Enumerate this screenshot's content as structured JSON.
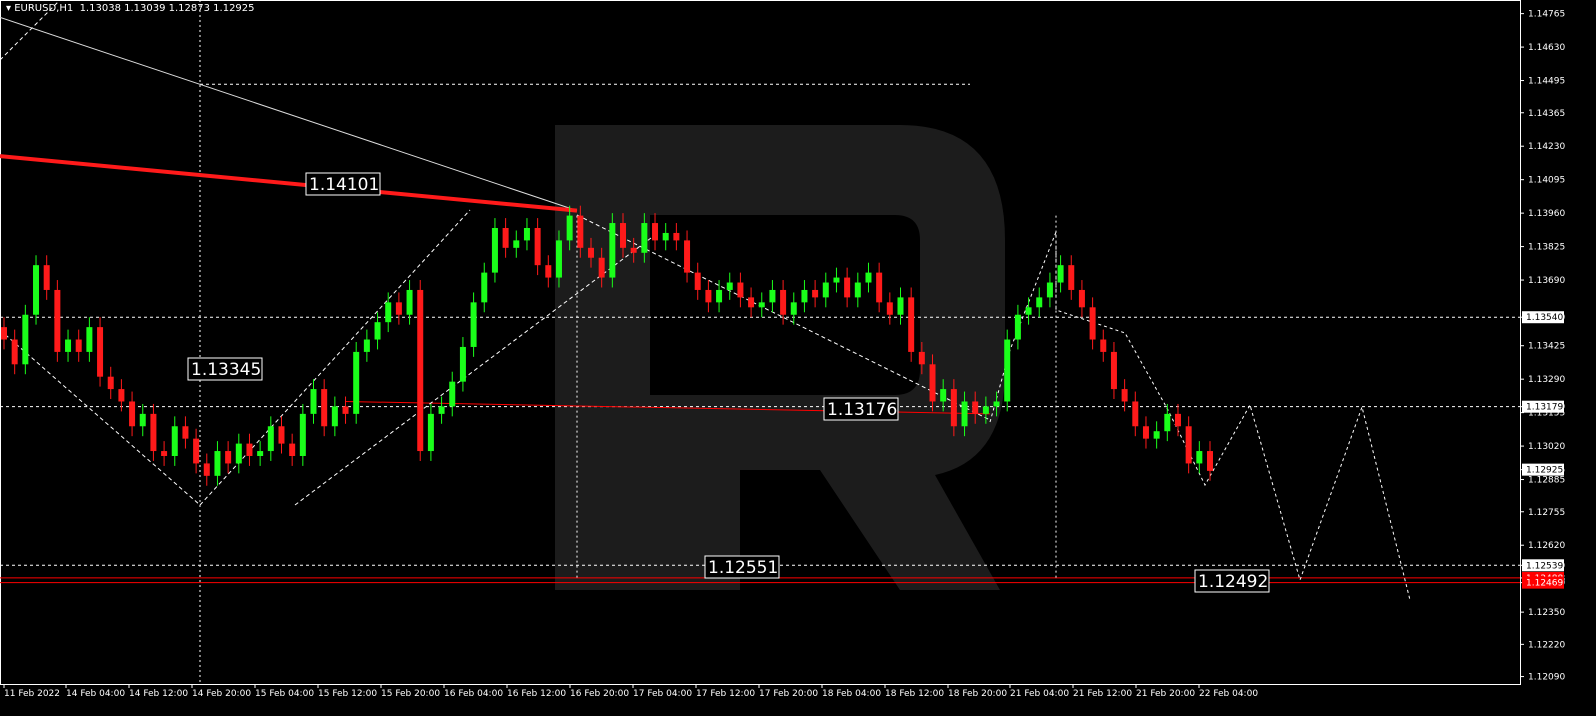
{
  "header": {
    "menu_icon": "triangle-down-icon",
    "text": "EURUSD,H1  1.13038 1.13039 1.12873 1.12925"
  },
  "chart_data": {
    "type": "candlestick",
    "symbol": "EURUSD",
    "timeframe": "H1",
    "ohlc": {
      "open": 1.13038,
      "high": 1.13039,
      "low": 1.12873,
      "close": 1.12925
    },
    "ylim": [
      1.1206,
      1.1482
    ],
    "y_ticks": [
      "1.14765",
      "1.14630",
      "1.14495",
      "1.14365",
      "1.14230",
      "1.14095",
      "1.13960",
      "1.13825",
      "1.13690",
      "1.13540",
      "1.13425",
      "1.13290",
      "1.13179",
      "1.13155",
      "1.13020",
      "1.12925",
      "1.12885",
      "1.12755",
      "1.12620",
      "1.12539",
      "1.12488",
      "1.12469",
      "1.12350",
      "1.12220",
      "1.12090"
    ],
    "x_ticks": [
      "11 Feb 2022",
      "14 Feb 04:00",
      "14 Feb 12:00",
      "14 Feb 20:00",
      "15 Feb 04:00",
      "15 Feb 12:00",
      "15 Feb 20:00",
      "16 Feb 04:00",
      "16 Feb 12:00",
      "16 Feb 20:00",
      "17 Feb 04:00",
      "17 Feb 12:00",
      "17 Feb 20:00",
      "18 Feb 04:00",
      "18 Feb 12:00",
      "18 Feb 20:00",
      "21 Feb 04:00",
      "21 Feb 12:00",
      "21 Feb 20:00",
      "22 Feb 04:00"
    ],
    "price_labels": [
      {
        "value": "1.13540",
        "style": "white"
      },
      {
        "value": "1.13179",
        "style": "white"
      },
      {
        "value": "1.12925",
        "style": "white"
      },
      {
        "value": "1.12539",
        "style": "white"
      },
      {
        "value": "1.12488",
        "style": "red"
      },
      {
        "value": "1.12469",
        "style": "red"
      }
    ],
    "annotations": [
      "1.14101",
      "1.13345",
      "1.13176",
      "1.12551",
      "1.12492"
    ],
    "close_path": [
      1.1345,
      1.1335,
      1.1355,
      1.1375,
      1.1365,
      1.134,
      1.1345,
      1.134,
      1.135,
      1.133,
      1.1325,
      1.132,
      1.131,
      1.1315,
      1.13,
      1.1298,
      1.131,
      1.1305,
      1.1295,
      1.129,
      1.13,
      1.1295,
      1.1303,
      1.1298,
      1.13,
      1.131,
      1.1303,
      1.1298,
      1.1315,
      1.1325,
      1.131,
      1.1318,
      1.1315,
      1.134,
      1.1345,
      1.1352,
      1.136,
      1.1355,
      1.1365,
      1.13,
      1.1315,
      1.1318,
      1.1328,
      1.1342,
      1.136,
      1.1372,
      1.139,
      1.1382,
      1.1385,
      1.139,
      1.1375,
      1.137,
      1.1385,
      1.1395,
      1.1382,
      1.1378,
      1.137,
      1.1392,
      1.1382,
      1.138,
      1.1392,
      1.1385,
      1.1388,
      1.1385,
      1.1372,
      1.1365,
      1.136,
      1.1365,
      1.1368,
      1.1362,
      1.1358,
      1.136,
      1.1365,
      1.1355,
      1.136,
      1.1365,
      1.1362,
      1.1368,
      1.137,
      1.1362,
      1.1368,
      1.1372,
      1.136,
      1.1355,
      1.1362,
      1.134,
      1.1335,
      1.132,
      1.1325,
      1.131,
      1.132,
      1.1315,
      1.1318,
      1.132,
      1.1345,
      1.1355,
      1.1358,
      1.1362,
      1.1368,
      1.1375,
      1.1365,
      1.1358,
      1.1345,
      1.134,
      1.1325,
      1.132,
      1.131,
      1.1305,
      1.1308,
      1.1315,
      1.131,
      1.1295,
      1.13,
      1.1292
    ]
  }
}
